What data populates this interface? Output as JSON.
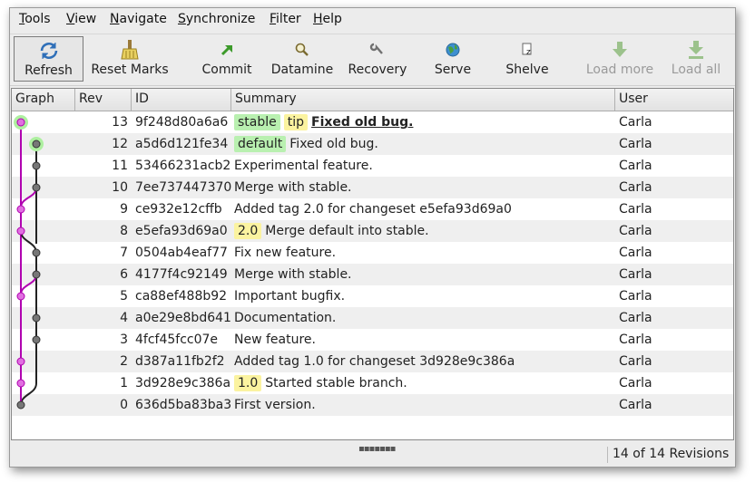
{
  "menubar": {
    "items": [
      {
        "label": "Tools"
      },
      {
        "label": "View"
      },
      {
        "label": "Navigate"
      },
      {
        "label": "Synchronize"
      },
      {
        "label": "Filter"
      },
      {
        "label": "Help"
      }
    ]
  },
  "toolbar": {
    "buttons": [
      {
        "label": "Refresh",
        "icon": "refresh-icon"
      },
      {
        "label": "Reset Marks",
        "icon": "broom-icon"
      },
      {
        "label": "Commit",
        "icon": "commit-arrow-icon"
      },
      {
        "label": "Datamine",
        "icon": "magnifier-icon"
      },
      {
        "label": "Recovery",
        "icon": "wrench-icon"
      },
      {
        "label": "Serve",
        "icon": "globe-icon"
      },
      {
        "label": "Shelve",
        "icon": "shelve-icon"
      },
      {
        "label": "Load more",
        "icon": "down-arrow-icon"
      },
      {
        "label": "Load all",
        "icon": "down-arrow-bar-icon"
      }
    ]
  },
  "table": {
    "columns": [
      "Graph",
      "Rev",
      "ID",
      "Summary",
      "User"
    ],
    "rows": [
      {
        "rev": "13",
        "id": "9f248d80a6a6",
        "tags": [
          {
            "text": "stable",
            "color": "green"
          },
          {
            "text": "tip",
            "color": "yellow"
          }
        ],
        "summary": "Fixed old bug.",
        "bold": true,
        "user": "Carla"
      },
      {
        "rev": "12",
        "id": "a5d6d121fe34",
        "tags": [
          {
            "text": "default",
            "color": "green"
          }
        ],
        "summary": "Fixed old bug.",
        "bold": false,
        "user": "Carla"
      },
      {
        "rev": "11",
        "id": "53466231acb2",
        "tags": [],
        "summary": "Experimental feature.",
        "bold": false,
        "user": "Carla"
      },
      {
        "rev": "10",
        "id": "7ee737447370",
        "tags": [],
        "summary": "Merge with stable.",
        "bold": false,
        "user": "Carla"
      },
      {
        "rev": "9",
        "id": "ce932e12cffb",
        "tags": [],
        "summary": "Added tag 2.0 for changeset e5efa93d69a0",
        "bold": false,
        "user": "Carla"
      },
      {
        "rev": "8",
        "id": "e5efa93d69a0",
        "tags": [
          {
            "text": "2.0",
            "color": "yellow"
          }
        ],
        "summary": "Merge default into stable.",
        "bold": false,
        "user": "Carla"
      },
      {
        "rev": "7",
        "id": "0504ab4eaf77",
        "tags": [],
        "summary": "Fix new feature.",
        "bold": false,
        "user": "Carla"
      },
      {
        "rev": "6",
        "id": "4177f4c92149",
        "tags": [],
        "summary": "Merge with stable.",
        "bold": false,
        "user": "Carla"
      },
      {
        "rev": "5",
        "id": "ca88ef488b92",
        "tags": [],
        "summary": "Important bugfix.",
        "bold": false,
        "user": "Carla"
      },
      {
        "rev": "4",
        "id": "a0e29e8bd641",
        "tags": [],
        "summary": "Documentation.",
        "bold": false,
        "user": "Carla"
      },
      {
        "rev": "3",
        "id": "4fcf45fcc07e",
        "tags": [],
        "summary": "New feature.",
        "bold": false,
        "user": "Carla"
      },
      {
        "rev": "2",
        "id": "d387a11fb2f2",
        "tags": [],
        "summary": "Added tag 1.0 for changeset 3d928e9c386a",
        "bold": false,
        "user": "Carla"
      },
      {
        "rev": "1",
        "id": "3d928e9c386a",
        "tags": [
          {
            "text": "1.0",
            "color": "yellow"
          }
        ],
        "summary": "Started stable branch.",
        "bold": false,
        "user": "Carla"
      },
      {
        "rev": "0",
        "id": "636d5ba83ba3",
        "tags": [],
        "summary": "First version.",
        "bold": false,
        "user": "Carla"
      }
    ]
  },
  "graph": {
    "stable_color": "#b000b0",
    "default_color": "#222222",
    "highlight_color": "#aef0a0"
  },
  "statusbar": {
    "text": "14 of 14 Revisions"
  }
}
